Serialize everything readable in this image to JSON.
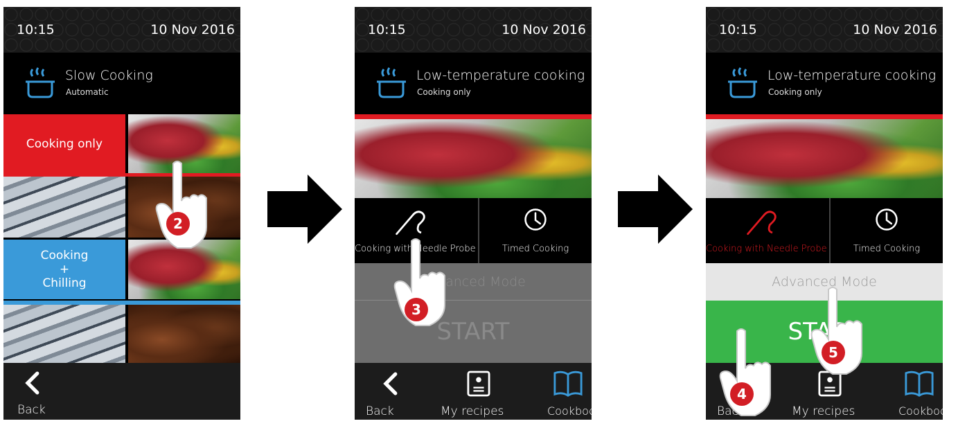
{
  "colors": {
    "accent_red": "#e11b22",
    "accent_blue": "#3a9ad9",
    "start_green": "#39b54a",
    "disabled_gray": "#6e6e6e",
    "advanced_light": "#e6e6e6"
  },
  "screens": [
    {
      "status": {
        "time": "10:15",
        "date": "10 Nov  2016"
      },
      "mode": {
        "title": "Slow Cooking",
        "subtitle": "Automatic",
        "icon": "steaming-pot-icon"
      },
      "tiles": {
        "cooking_only": "Cooking only",
        "cooking_chilling_line1": "Cooking",
        "cooking_chilling_plus": "+",
        "cooking_chilling_line2": "Chilling"
      },
      "nav": {
        "back": "Back"
      },
      "hand_step": "2"
    },
    {
      "status": {
        "time": "10:15",
        "date": "10 Nov  2016"
      },
      "mode": {
        "title": "Low-temperature cooking",
        "subtitle": "Cooking only",
        "icon": "steaming-pot-icon"
      },
      "options": {
        "needle": "Cooking with Needle Probe",
        "timed": "Timed Cooking"
      },
      "advanced": "Advanced Mode",
      "start": "START",
      "nav": {
        "back": "Back",
        "recipes": "My recipes",
        "cookbook": "Cookbook"
      },
      "hand_step": "3"
    },
    {
      "status": {
        "time": "10:15",
        "date": "10 Nov  2016"
      },
      "mode": {
        "title": "Low-temperature cooking",
        "subtitle": "Cooking only",
        "icon": "steaming-pot-icon"
      },
      "options": {
        "needle": "Cooking with Needle Probe",
        "timed": "Timed Cooking"
      },
      "advanced": "Advanced Mode",
      "start": "START",
      "nav": {
        "back": "Back",
        "recipes": "My recipes",
        "cookbook": "Cookbook"
      },
      "hand_steps": [
        "4",
        "5"
      ]
    }
  ]
}
